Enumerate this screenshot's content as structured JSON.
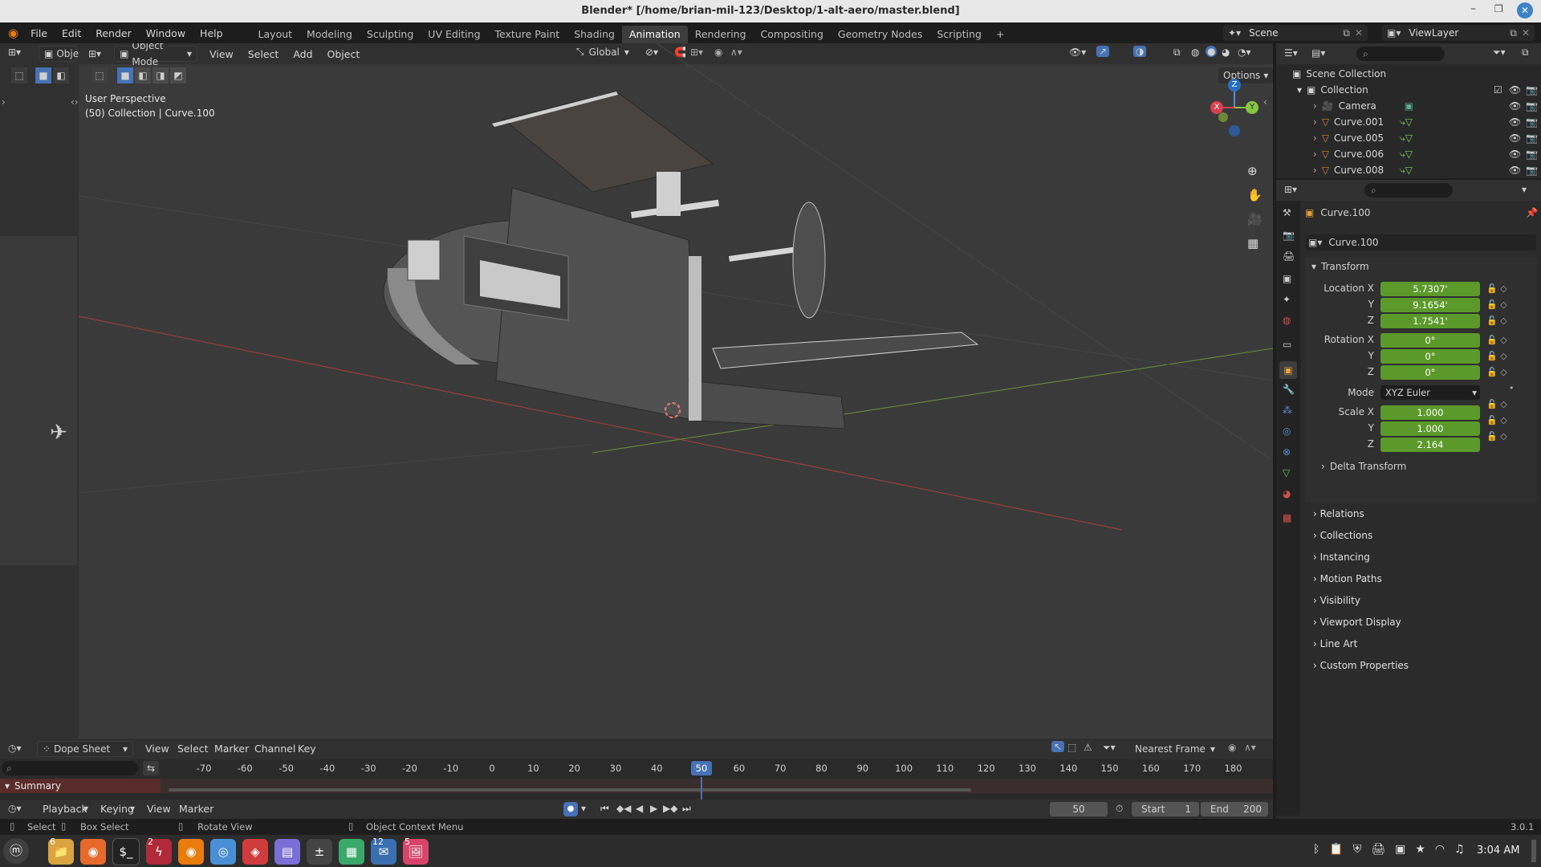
{
  "window": {
    "title": "Blender* [/home/brian-mil-123/Desktop/1-alt-aero/master.blend]"
  },
  "menu": [
    "File",
    "Edit",
    "Render",
    "Window",
    "Help"
  ],
  "workspaces": [
    "Layout",
    "Modeling",
    "Sculpting",
    "UV Editing",
    "Texture Paint",
    "Shading",
    "Animation",
    "Rendering",
    "Compositing",
    "Geometry Nodes",
    "Scripting"
  ],
  "active_workspace": "Animation",
  "scene": {
    "name": "Scene",
    "viewlayer": "ViewLayer"
  },
  "viewport": {
    "mode": "Object Mode",
    "left_mode": "Obje",
    "menus": [
      "View",
      "Select",
      "Add",
      "Object"
    ],
    "orientation": "Global",
    "options_label": "Options",
    "info_line1": "User Perspective",
    "info_line2": "(50) Collection | Curve.100",
    "gizmo": {
      "x": "X",
      "y": "Y",
      "z": "Z"
    }
  },
  "outliner": {
    "root": "Scene Collection",
    "collection": "Collection",
    "items": [
      {
        "name": "Camera",
        "icon": "camera-icon"
      },
      {
        "name": "Curve.001",
        "icon": "curve-icon"
      },
      {
        "name": "Curve.005",
        "icon": "curve-icon"
      },
      {
        "name": "Curve.006",
        "icon": "curve-icon"
      },
      {
        "name": "Curve.008",
        "icon": "curve-icon"
      }
    ]
  },
  "properties": {
    "object_name": "Curve.100",
    "datablock_name": "Curve.100",
    "transform_label": "Transform",
    "location_label": "Location X",
    "rotation_label": "Rotation X",
    "scale_label": "Scale X",
    "y_label": "Y",
    "z_label": "Z",
    "mode_label": "Mode",
    "location": {
      "x": "5.7307'",
      "y": "9.1654'",
      "z": "1.7541'"
    },
    "rotation": {
      "x": "0°",
      "y": "0°",
      "z": "0°"
    },
    "rotation_mode": "XYZ Euler",
    "scale": {
      "x": "1.000",
      "y": "1.000",
      "z": "2.164"
    },
    "delta": "Delta Transform",
    "panels": [
      "Relations",
      "Collections",
      "Instancing",
      "Motion Paths",
      "Visibility",
      "Viewport Display",
      "Line Art",
      "Custom Properties"
    ]
  },
  "dopesheet": {
    "editor": "Dope Sheet",
    "menus": [
      "View",
      "Select",
      "Marker",
      "Channel",
      "Key"
    ],
    "snapping": "Nearest Frame",
    "summary": "Summary",
    "ticks": [
      "-70",
      "-60",
      "-50",
      "-40",
      "-30",
      "-20",
      "-10",
      "0",
      "10",
      "20",
      "30",
      "40",
      "50",
      "60",
      "70",
      "80",
      "90",
      "100",
      "110",
      "120",
      "130",
      "140",
      "150",
      "160",
      "170",
      "180"
    ],
    "current_frame": "50"
  },
  "timeline": {
    "menus": [
      "Playback",
      "Keying",
      "View",
      "Marker"
    ],
    "frame": "50",
    "start_label": "Start",
    "start": "1",
    "end_label": "End",
    "end": "200"
  },
  "statusbar": {
    "select": "Select",
    "box_select": "Box Select",
    "rotate": "Rotate View",
    "context": "Object Context Menu",
    "version": "3.0.1"
  },
  "taskbar": {
    "clock": "3:04 AM",
    "badges": {
      "files": "6",
      "shell": "2",
      "mail": "12",
      "photos": "5"
    }
  },
  "colors": {
    "accent_green": "#5b9a2a",
    "active_blue": "#4772b3",
    "title_bg": "#e8e8e8",
    "viewport_bg": "#3a3a3a"
  }
}
